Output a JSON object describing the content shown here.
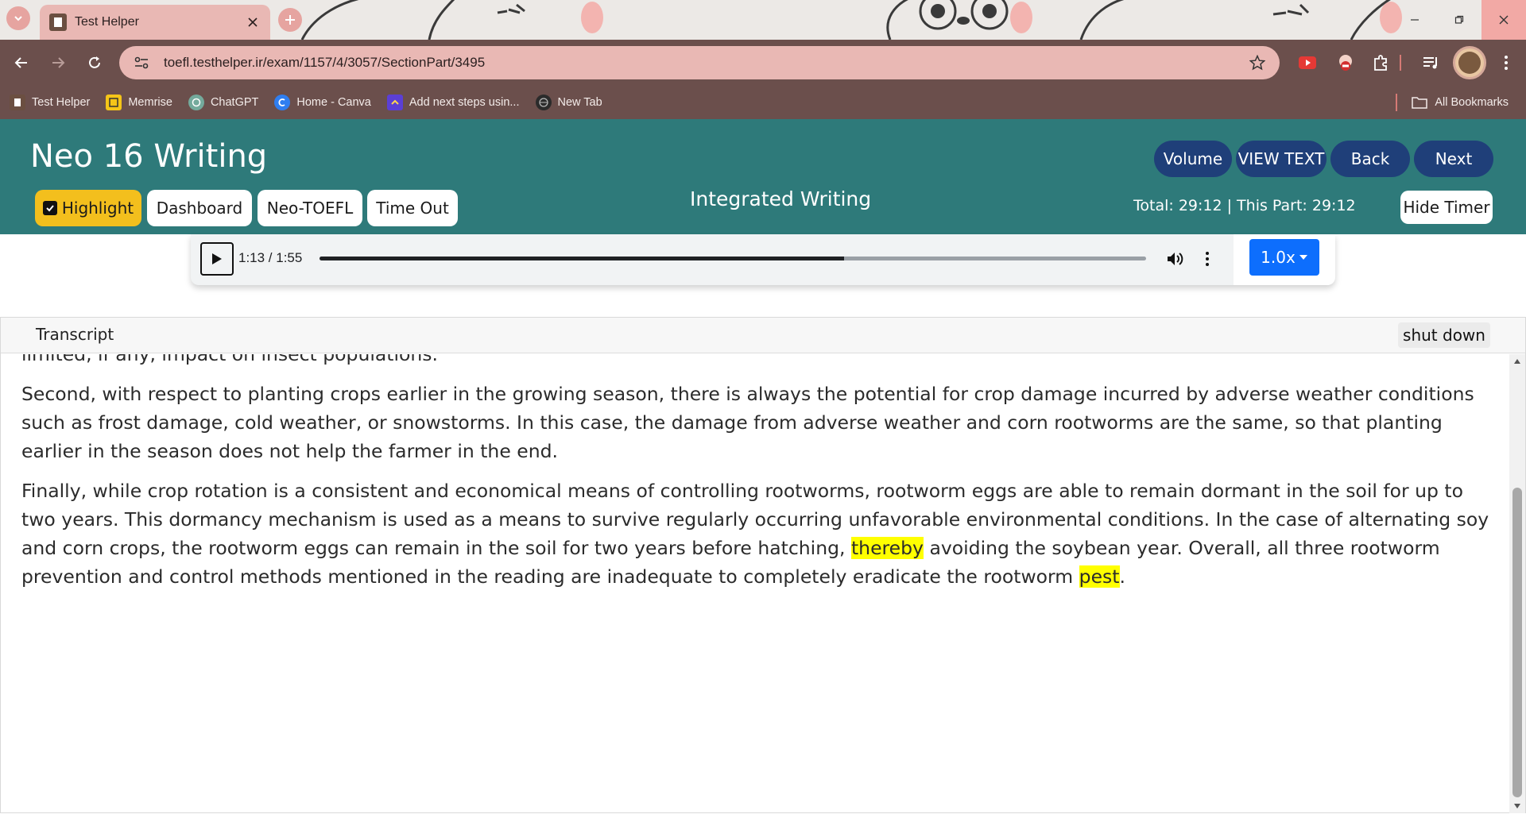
{
  "browser": {
    "tab_title": "Test Helper",
    "url": "toefl.testhelper.ir/exam/1157/4/3057/SectionPart/3495",
    "bookmarks": [
      {
        "label": "Test Helper",
        "icon": "test-helper-favicon"
      },
      {
        "label": "Memrise",
        "icon": "memrise-favicon"
      },
      {
        "label": "ChatGPT",
        "icon": "chatgpt-favicon"
      },
      {
        "label": "Home - Canva",
        "icon": "canva-favicon"
      },
      {
        "label": "Add next steps usin...",
        "icon": "clickup-favicon"
      },
      {
        "label": "New Tab",
        "icon": "globe-favicon"
      }
    ],
    "all_bookmarks_label": "All Bookmarks",
    "colors": {
      "titlebar": "#ece9e6",
      "toolbar": "#6b4f4c",
      "tab": "#e9b8b4",
      "omnibox": "#e9b8b4"
    }
  },
  "app": {
    "title": "Neo 16 Writing",
    "header_buttons": {
      "volume": "Volume",
      "view_text": "VIEW TEXT",
      "back": "Back",
      "next": "Next"
    },
    "toolbar_buttons": {
      "highlight": "Highlight",
      "dashboard": "Dashboard",
      "neo_toefl": "Neo-TOEFL",
      "time_out": "Time Out"
    },
    "section_name": "Integrated Writing",
    "timer": "Total: 29:12 | This Part: 29:12",
    "hide_timer": "Hide Timer",
    "colors": {
      "header_bg": "#2e7a7a",
      "pill_bg": "#1f3f79",
      "highlight_btn": "#f3bf1d",
      "speed_btn": "#0d6efd",
      "text_highlight": "#ffff00"
    }
  },
  "player": {
    "current_time": "1:13",
    "duration": "1:55",
    "time_display": "1:13 / 1:55",
    "progress_fraction": 0.635,
    "speed": "1.0x"
  },
  "transcript": {
    "title": "Transcript",
    "shut_down_label": "shut down",
    "paragraphs": {
      "p1": "limited, if any, impact on insect populations.",
      "p2": "Second, with respect to planting crops earlier in the growing season, there is always the potential for crop damage incurred by adverse weather conditions such as frost damage, cold weather, or snowstorms. In this case, the damage from adverse weather and corn rootworms are the same, so that planting earlier in the season does not help the farmer in the end.",
      "p3_a": "Finally, while crop rotation is a consistent and economical means of controlling rootworms, rootworm eggs are able to remain dormant in the soil for up to two years. This dormancy mechanism is used as a means to survive regularly occurring unfavorable environmental conditions. In the case of alternating soy and corn crops, the rootworm eggs can remain in the soil for two years before hatching, ",
      "p3_hl1": "thereby",
      "p3_b": " avoiding the soybean year. Overall, all three rootworm prevention and control methods mentioned in the reading are inadequate to completely eradicate the rootworm ",
      "p3_hl2": "pest",
      "p3_c": "."
    }
  }
}
